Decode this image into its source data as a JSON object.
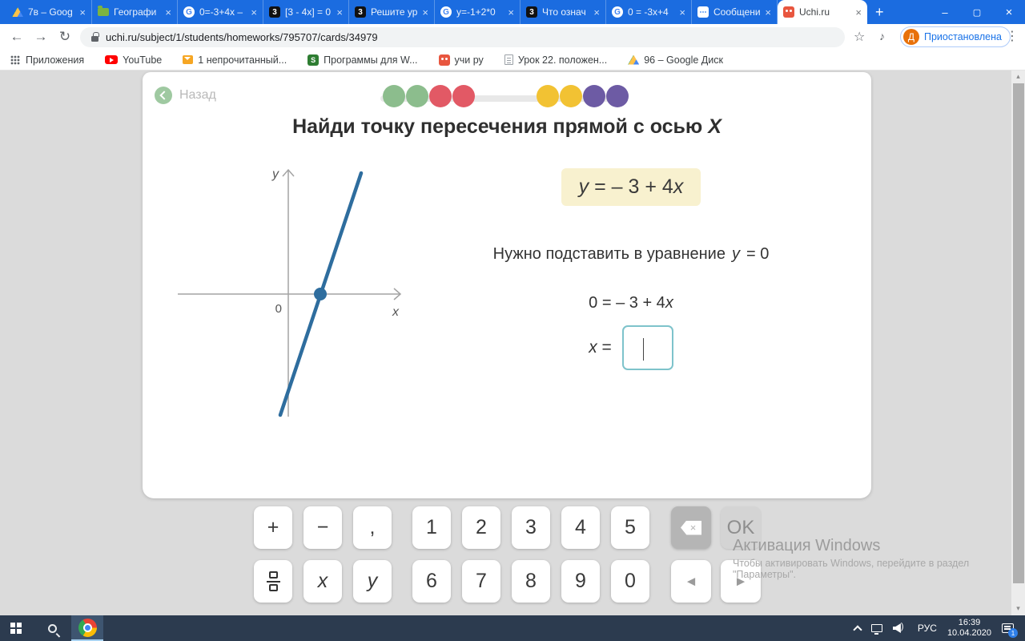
{
  "browser": {
    "tabs": [
      {
        "title": "7в – Goog"
      },
      {
        "title": "Географи"
      },
      {
        "title": "0=-3+4x –"
      },
      {
        "title": "[3 - 4x] = 0"
      },
      {
        "title": "Решите ур"
      },
      {
        "title": "y=-1+2*0"
      },
      {
        "title": "Что означ"
      },
      {
        "title": "0 = -3x+4"
      },
      {
        "title": "Сообщени"
      },
      {
        "title": "Uchi.ru"
      }
    ],
    "close_glyph": "×",
    "new_tab": "+",
    "url": "uchi.ru/subject/1/students/homeworks/795707/cards/34979",
    "profile": {
      "initial": "Д",
      "label": "Приостановлена"
    },
    "bookmarks": [
      "Приложения",
      "YouTube",
      "1 непрочитанный...",
      "Программы для W...",
      "учи ру",
      "Урок 22. положен...",
      "96 – Google Диск"
    ]
  },
  "icons": {
    "back": "←",
    "forward": "→",
    "refresh": "↻",
    "star": "☆",
    "menu": "⋮",
    "minimize": "–",
    "maximize": "▢",
    "close": "×",
    "fav_g": "G",
    "fav_3": "3",
    "fav_s": "S",
    "scroll_up": "▴",
    "scroll_down": "▾",
    "arrow_left": "◄",
    "arrow_right": "►",
    "backspace_x": "×",
    "vol_wave": ")"
  },
  "lesson": {
    "back_label": "Назад",
    "title_main": "Найди точку пересечения прямой с осью ",
    "title_var": "X",
    "equation": {
      "lhs": "y",
      "mid": " = – 3 + 4",
      "var": "x"
    },
    "instruction": {
      "text": "Нужно подставить в уравнение",
      "var": "y",
      "tail": "= 0"
    },
    "step": {
      "lhs": "0 = – 3 + 4",
      "var": "x"
    },
    "answer": {
      "var": "x",
      "eq": "="
    },
    "graph": {
      "y_label": "y",
      "x_label": "x",
      "origin": "0"
    }
  },
  "keyboard": {
    "row1": [
      "+",
      "−",
      ",",
      "1",
      "2",
      "3",
      "4",
      "5"
    ],
    "row2": [
      "x",
      "y",
      "6",
      "7",
      "8",
      "9",
      "0"
    ],
    "ok": "OK"
  },
  "watermark": {
    "title": "Активация Windows",
    "line1": "Чтобы активировать Windows, перейдите в раздел",
    "line2": "\"Параметры\"."
  },
  "taskbar": {
    "lang": "РУС",
    "time": "16:39",
    "date": "10.04.2020",
    "badge": "1"
  },
  "colors": {
    "progress": [
      "#8cbd8d",
      "#8cbd8d",
      "#e25965",
      "#e25965",
      "#f2c233",
      "#f2c233",
      "#6d5ba4",
      "#6d5ba4"
    ],
    "tabbar": "#1b6ce0",
    "line": "#2e6d9e",
    "input_border": "#7ec3cb",
    "eq_box": "#f8f1cf"
  }
}
